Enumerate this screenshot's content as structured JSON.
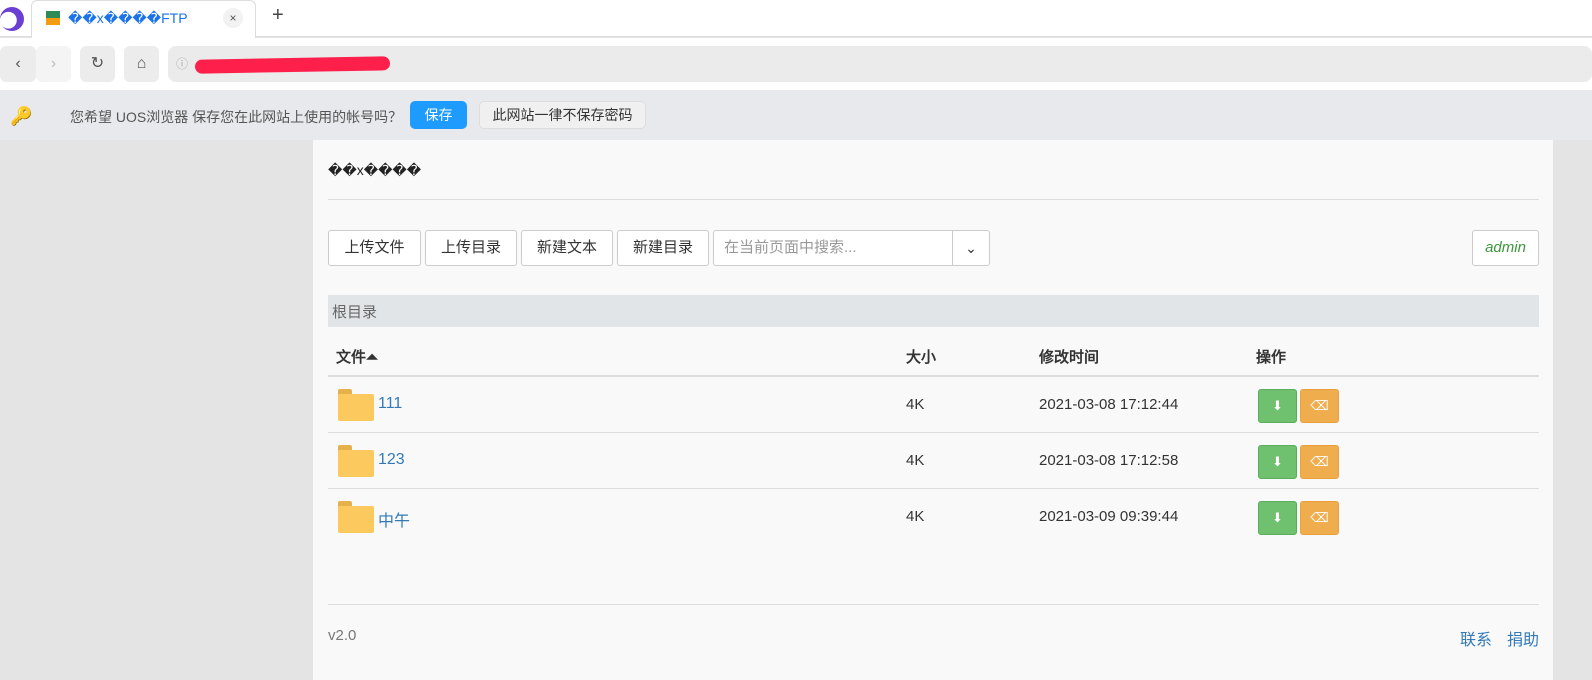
{
  "browser": {
    "tab_title": "��x����FTP",
    "close": "×",
    "new_tab": "+",
    "back": "‹",
    "forward": "›",
    "reload": "↻",
    "home": "⌂"
  },
  "infobar": {
    "message": "您希望 UOS浏览器 保存您在此网站上使用的帐号吗？",
    "save": "保存",
    "never": "此网站一律不保存密码"
  },
  "page": {
    "title": "��x����",
    "toolbar": {
      "upload_file": "上传文件",
      "upload_dir": "上传目录",
      "new_text": "新建文本",
      "new_dir": "新建目录",
      "search_placeholder": "在当前页面中搜索...",
      "user": "admin"
    },
    "breadcrumb": "根目录",
    "columns": {
      "file": "文件",
      "size": "大小",
      "mtime": "修改时间",
      "ops": "操作"
    },
    "rows": [
      {
        "name": "111",
        "size": "4K",
        "mtime": "2021-03-08 17:12:44"
      },
      {
        "name": "123",
        "size": "4K",
        "mtime": "2021-03-08 17:12:58"
      },
      {
        "name": "中午",
        "size": "4K",
        "mtime": "2021-03-09 09:39:44"
      }
    ],
    "footer": {
      "version": "v2.0",
      "contact": "联系",
      "donate": "捐助"
    }
  }
}
